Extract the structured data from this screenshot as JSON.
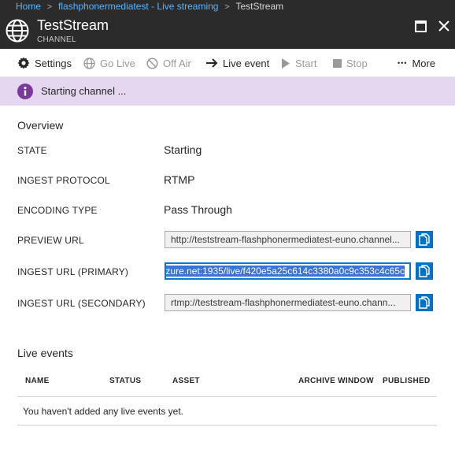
{
  "breadcrumb": {
    "items": [
      "Home",
      "flashphonermediatest - Live streaming",
      "TestStream"
    ],
    "separator": ">"
  },
  "header": {
    "title": "TestStream",
    "subtitle": "CHANNEL",
    "icon": "globe-icon"
  },
  "toolbar": {
    "settings": "Settings",
    "go_live": "Go Live",
    "off_air": "Off Air",
    "live_event": "Live event",
    "start": "Start",
    "stop": "Stop",
    "more_glyph": "•••",
    "more": "More"
  },
  "notification": {
    "text": "Starting channel ...",
    "color": "#e5d7ef"
  },
  "overview": {
    "title": "Overview",
    "state_label": "STATE",
    "state_value": "Starting",
    "ingest_protocol_label": "INGEST PROTOCOL",
    "ingest_protocol_value": "RTMP",
    "encoding_type_label": "ENCODING TYPE",
    "encoding_type_value": "Pass Through",
    "preview_url_label": "PREVIEW URL",
    "preview_url_value": "http://teststream-flashphonermediatest-euno.channel...",
    "ingest_primary_label": "INGEST URL (PRIMARY)",
    "ingest_primary_value": "zure.net:1935/live/f420e5a25c614c3380a0c9c353c4c65c",
    "ingest_secondary_label": "INGEST URL (SECONDARY)",
    "ingest_secondary_value": "rtmp://teststream-flashphonermediatest-euno.chann..."
  },
  "live_events": {
    "title": "Live events",
    "columns": [
      "NAME",
      "STATUS",
      "ASSET",
      "ARCHIVE WINDOW",
      "PUBLISHED"
    ],
    "empty_message": "You haven't added any live events yet."
  },
  "colors": {
    "accent": "#0072c6",
    "header_bg": "#2b2b2b",
    "link": "#59b4ff",
    "info_purple": "#7a3a9c"
  }
}
